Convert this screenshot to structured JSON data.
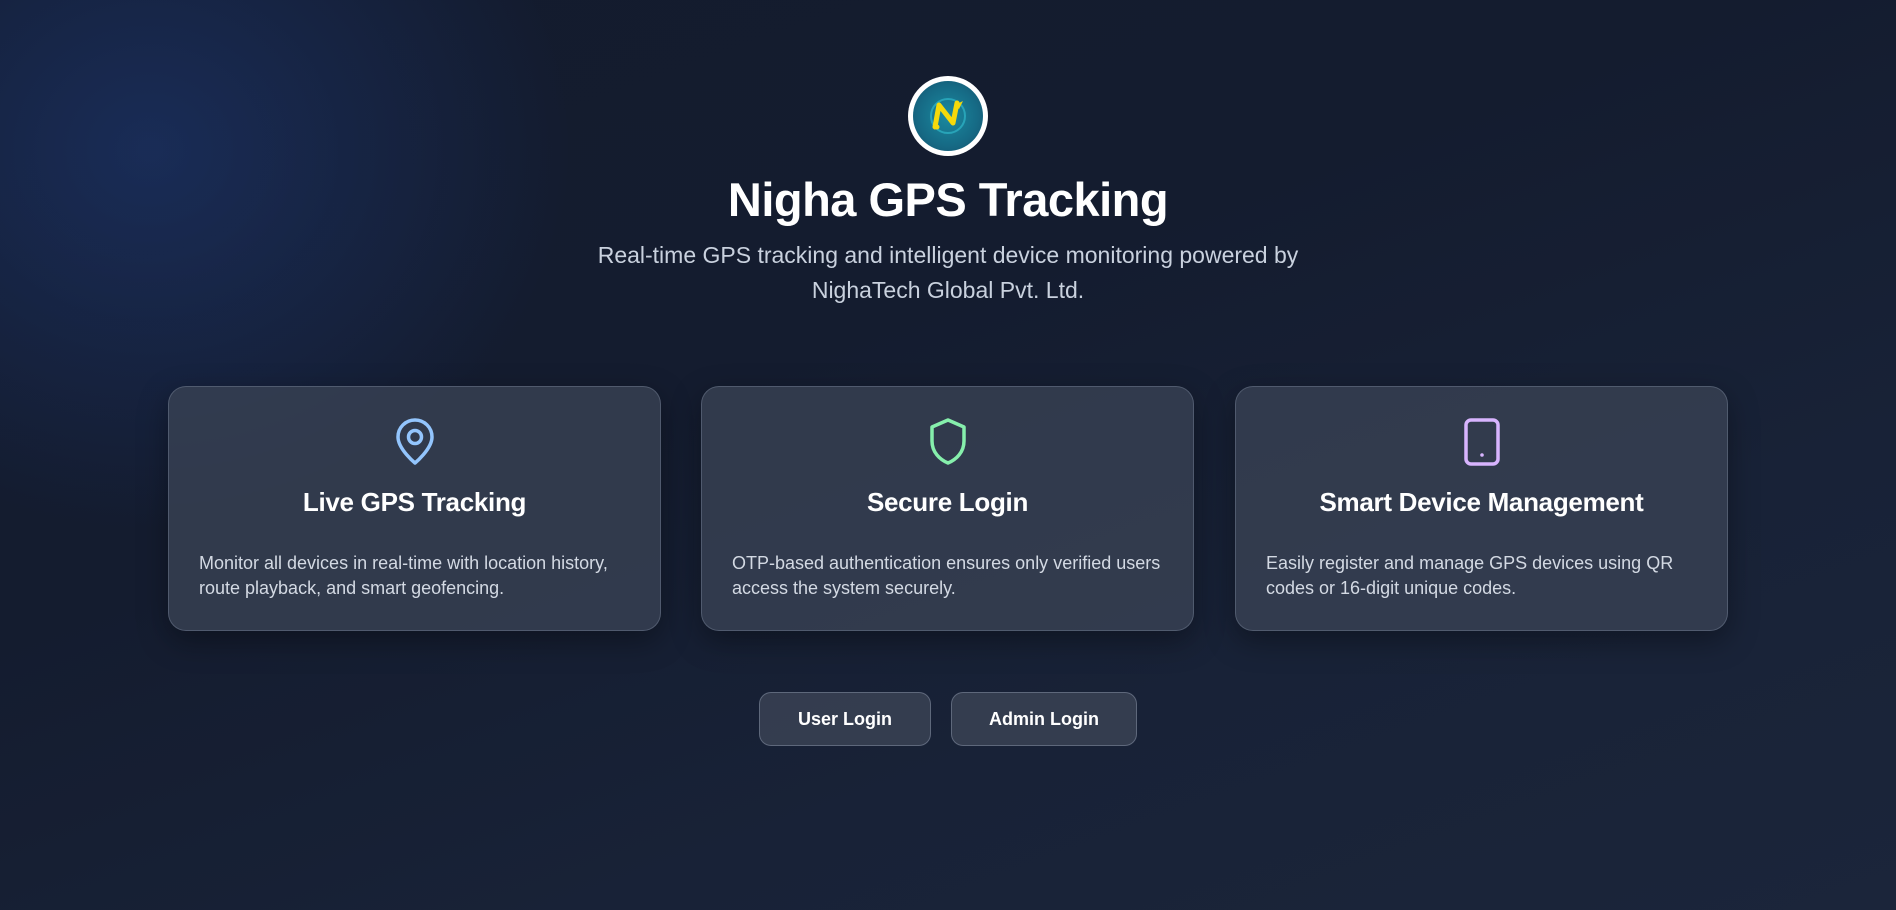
{
  "header": {
    "logo_icon": "nigha-logo-icon",
    "title": "Nigha GPS Tracking",
    "subtitle": "Real-time GPS tracking and intelligent device monitoring powered by NighaTech Global Pvt. Ltd."
  },
  "features": [
    {
      "icon": "map-pin-icon",
      "icon_color": "#93c5fd",
      "title": "Live GPS Tracking",
      "description": "Monitor all devices in real-time with location history, route playback, and smart geofencing."
    },
    {
      "icon": "shield-icon",
      "icon_color": "#86efac",
      "title": "Secure Login",
      "description": "OTP-based authentication ensures only verified users access the system securely."
    },
    {
      "icon": "tablet-icon",
      "icon_color": "#d8b4fe",
      "title": "Smart Device Management",
      "description": "Easily register and manage GPS devices using QR codes or 16-digit unique codes."
    }
  ],
  "actions": {
    "user_login_label": "User Login",
    "admin_login_label": "Admin Login"
  },
  "colors": {
    "background": "#141c2f",
    "card": "#3a4254",
    "text_primary": "#ffffff",
    "text_secondary": "#c9d1de"
  }
}
